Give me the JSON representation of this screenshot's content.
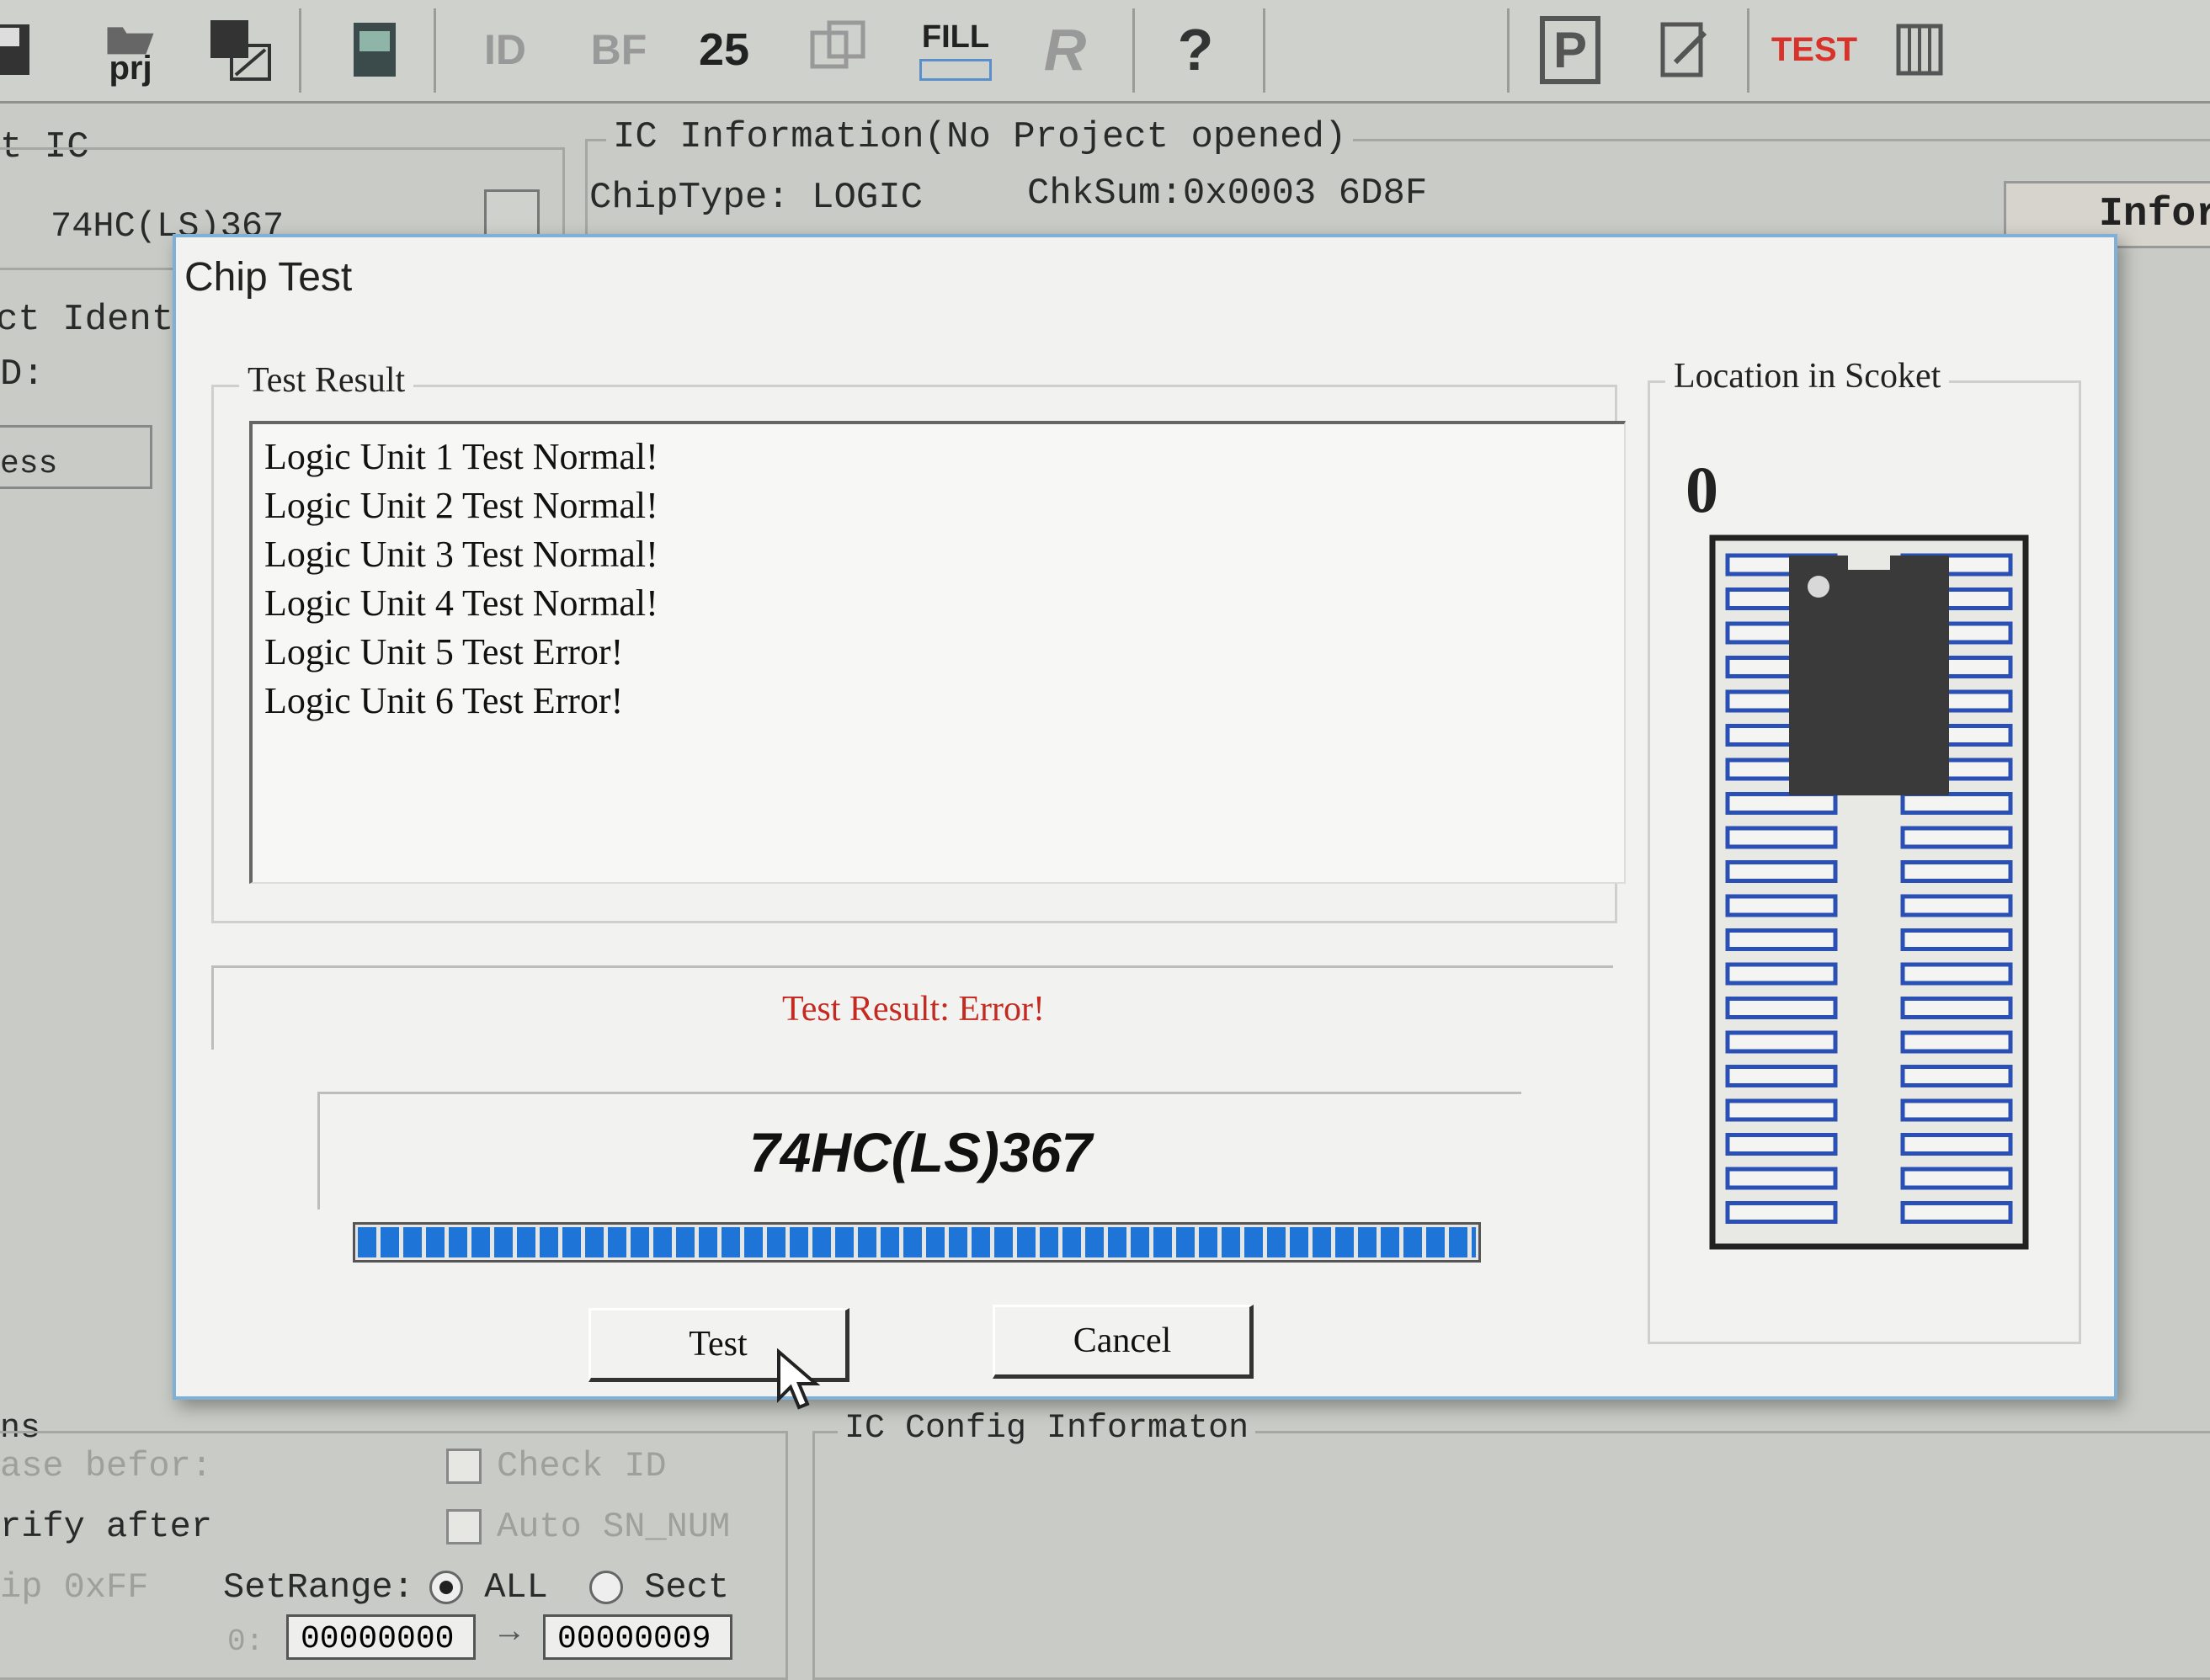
{
  "toolbar": {
    "prj_label": "prj",
    "fill_label": "FILL",
    "test_label": "TEST",
    "items": [
      "save-icon",
      "open-project-icon",
      "save-project-icon",
      "memory-icon",
      "read-id-icon",
      "blank-check-icon",
      "erase-icon",
      "verify-icon",
      "fill-icon",
      "read-icon",
      "help-icon",
      "program-icon",
      "edit-icon",
      "test-icon",
      "chip-icon"
    ]
  },
  "bg": {
    "select_ic_legend": "t IC",
    "ic_select_value": "74HC(LS)367",
    "ic_info_legend": "IC Information(No Project opened)",
    "chip_type": "ChipType: LOGIC",
    "checksum": "ChkSum:0x0003 6D8F",
    "product_ident": "ct Ident:",
    "id_label": "D:",
    "address_label": "ess",
    "info_tab": "Infor",
    "options_legend": "ns",
    "erase_before": "ase befor:",
    "verify_after": "rify after",
    "skip_ff": "ip 0xFF",
    "check_id": "Check ID",
    "auto_sn": "Auto SN_NUM",
    "set_range": "SetRange:",
    "range_all": "ALL",
    "range_sect": "Sect",
    "range_prefix": "0:",
    "range_start": "00000000",
    "range_end": "00000009",
    "config_legend": "IC Config Informaton"
  },
  "dialog": {
    "title": "Chip Test",
    "result_legend": "Test Result",
    "results": [
      "Logic Unit 1 Test Normal!",
      "Logic Unit 2 Test Normal!",
      "Logic Unit 3 Test Normal!",
      "Logic Unit 4 Test Normal!",
      "Logic Unit 5 Test Error!",
      "Logic Unit 6 Test Error!"
    ],
    "summary": "Test Result: Error!",
    "chip_name": "74HC(LS)367",
    "progress": 1.0,
    "test_button": "Test",
    "cancel_button": "Cancel",
    "socket_legend": "Location in Scoket",
    "socket_digit": "0"
  },
  "colors": {
    "error_text": "#c42a22",
    "progress_fill": "#1f74d8",
    "socket_pin": "#2a4fb5"
  }
}
